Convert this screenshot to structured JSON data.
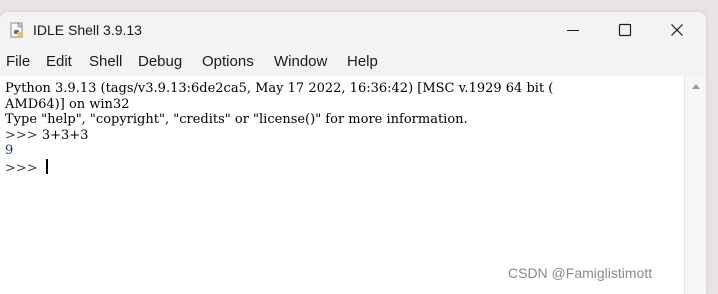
{
  "window": {
    "title": "IDLE Shell 3.9.13",
    "controls": [
      "minimize",
      "maximize",
      "close"
    ]
  },
  "menu": [
    "File",
    "Edit",
    "Shell",
    "Debug",
    "Options",
    "Window",
    "Help"
  ],
  "console": {
    "banner_line1": "Python 3.9.13 (tags/v3.9.13:6de2ca5, May 17 2022, 16:36:42) [MSC v.1929 64 bit (",
    "banner_line2": "AMD64)] on win32",
    "banner_line3": "Type \"help\", \"copyright\", \"credits\" or \"license()\" for more information.",
    "prompt1": ">>> ",
    "input1": "3+3+3",
    "output1": "9",
    "prompt2": ">>> "
  },
  "icons": {
    "app": "python-idle-icon",
    "minimize": "minimize-icon",
    "maximize": "maximize-icon",
    "close": "close-icon",
    "scroll_up": "scroll-up-arrow-icon"
  },
  "colors": {
    "output_text": "#1f2fa0",
    "titlebar_bg": "#f3f3f3"
  },
  "watermark": "CSDN @Famiglistimott"
}
